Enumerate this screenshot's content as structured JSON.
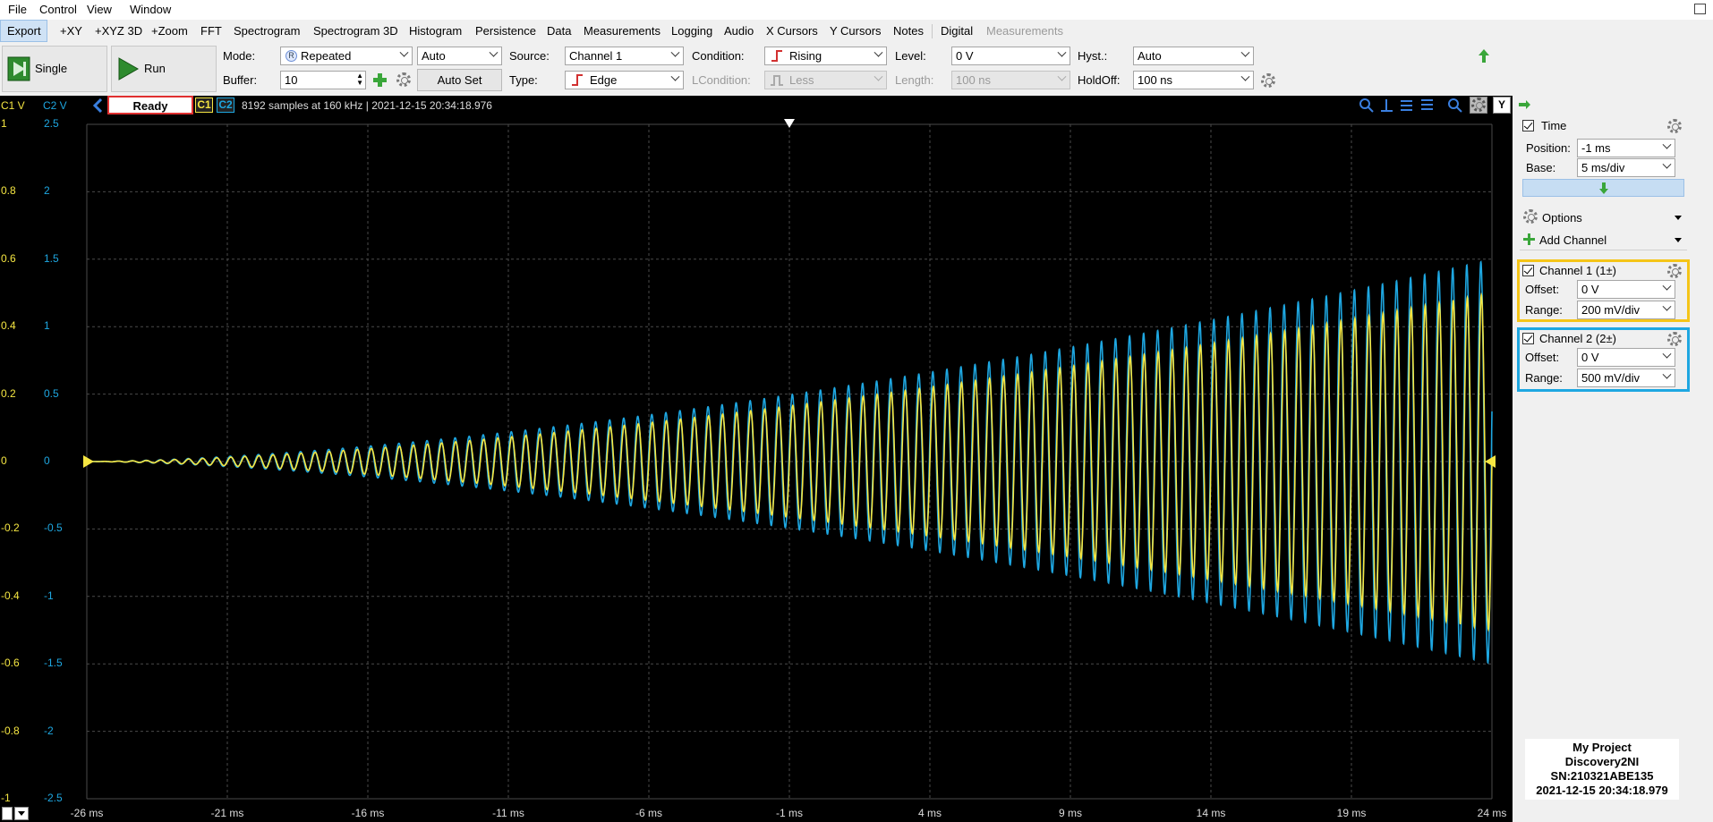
{
  "menu": [
    "File",
    "Control",
    "View",
    "Window"
  ],
  "toolbar": {
    "export": "Export",
    "items": [
      "+XY",
      "+XYZ 3D",
      "+Zoom",
      "FFT",
      "Spectrogram",
      "Spectrogram 3D",
      "Histogram",
      "Persistence",
      "Data",
      "Measurements",
      "Logging",
      "Audio",
      "X Cursors",
      "Y Cursors",
      "Notes",
      "Digital"
    ],
    "disabled_item": "Measurements"
  },
  "controls": {
    "single": "Single",
    "run": "Run",
    "mode_label": "Mode:",
    "mode_value": "Repeated",
    "trigger_mode": "Auto",
    "buffer_label": "Buffer:",
    "buffer_value": "10",
    "autoset": "Auto Set",
    "source_label": "Source:",
    "source_value": "Channel 1",
    "type_label": "Type:",
    "type_value": "Edge",
    "condition_label": "Condition:",
    "condition_value": "Rising",
    "lcondition_label": "LCondition:",
    "lcondition_value": "Less",
    "level_label": "Level:",
    "level_value": "0 V",
    "length_label": "Length:",
    "length_value": "100 ns",
    "hyst_label": "Hyst.:",
    "hyst_value": "Auto",
    "holdoff_label": "HoldOff:",
    "holdoff_value": "100 ns"
  },
  "status": {
    "c1v": "C1 V",
    "c2v": "C2 V",
    "state": "Ready",
    "c1": "C1",
    "c2": "C2",
    "info": "8192 samples at 160 kHz | 2021-12-15 20:34:18.976",
    "y_button": "Y"
  },
  "yaxis": {
    "c1": [
      "1",
      "0.8",
      "0.6",
      "0.4",
      "0.2",
      "0",
      "-0.2",
      "-0.4",
      "-0.6",
      "-0.8",
      "-1"
    ],
    "c2": [
      "2.5",
      "2",
      "1.5",
      "1",
      "0.5",
      "0",
      "-0.5",
      "-1",
      "-1.5",
      "-2",
      "-2.5"
    ]
  },
  "xaxis": [
    "-26 ms",
    "-21 ms",
    "-16 ms",
    "-11 ms",
    "-6 ms",
    "-1 ms",
    "4 ms",
    "9 ms",
    "14 ms",
    "19 ms",
    "24 ms"
  ],
  "panel": {
    "time_title": "Time",
    "position_label": "Position:",
    "position_value": "-1 ms",
    "base_label": "Base:",
    "base_value": "5 ms/div",
    "options": "Options",
    "add_channel": "Add Channel",
    "ch1_title": "Channel 1 (1±)",
    "ch1_offset_label": "Offset:",
    "ch1_offset": "0 V",
    "ch1_range_label": "Range:",
    "ch1_range": "200 mV/div",
    "ch2_title": "Channel 2 (2±)",
    "ch2_offset_label": "Offset:",
    "ch2_offset": "0 V",
    "ch2_range_label": "Range:",
    "ch2_range": "500 mV/div"
  },
  "info_box": {
    "project": "My Project",
    "device": "Discovery2NI",
    "serial": "SN:210321ABE135",
    "timestamp": "2021-12-15 20:34:18.979"
  },
  "colors": {
    "channel1": "#f5e642",
    "channel2": "#1ea7e1",
    "ready_border": "#e03030",
    "grid": "#4a4a4a",
    "background": "#000000"
  },
  "chart_data": {
    "type": "line",
    "xlabel": "",
    "ylabel": "",
    "x_unit": "ms",
    "xlim": [
      -26,
      24
    ],
    "series": [
      {
        "name": "C1",
        "ylim": [
          -1,
          1
        ],
        "amplitude_start": 0.0,
        "amplitude_end": 0.5,
        "cycles": 100
      },
      {
        "name": "C2",
        "ylim": [
          -2.5,
          2.5
        ],
        "amplitude_start": 0.0,
        "amplitude_end": 1.5,
        "cycles": 100
      }
    ]
  }
}
